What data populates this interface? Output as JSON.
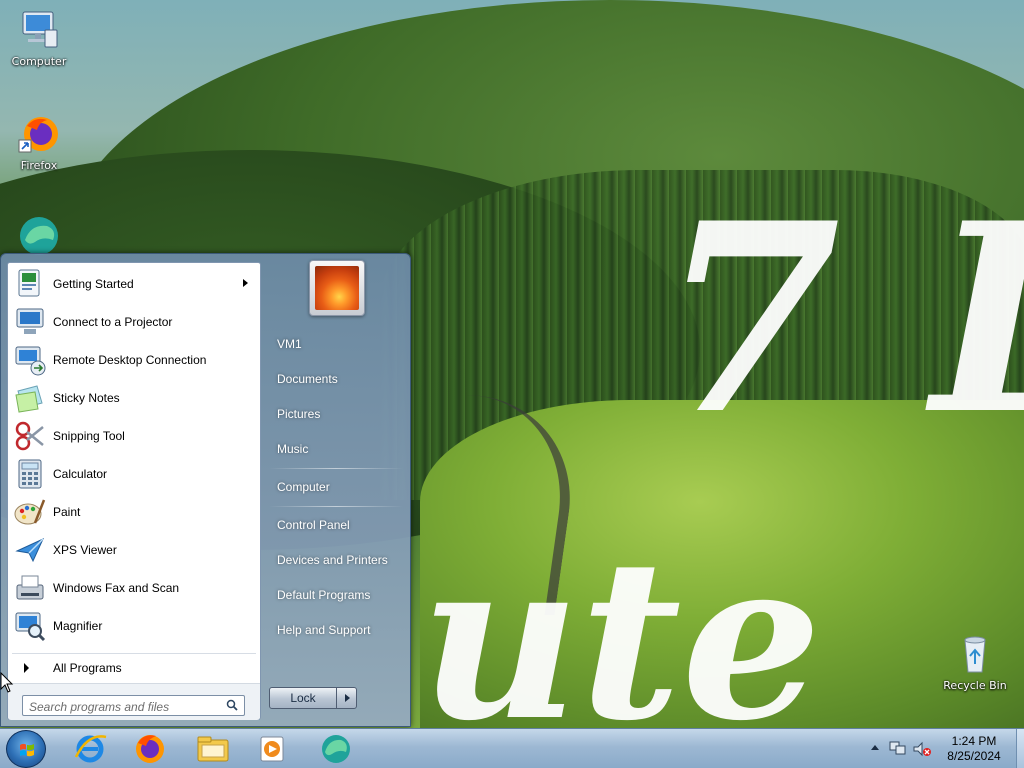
{
  "desktop": {
    "icons": [
      {
        "label": "Computer",
        "icon": "computer-icon"
      },
      {
        "label": "Firefox",
        "icon": "firefox-icon"
      },
      {
        "label": "",
        "icon": "edge-icon"
      },
      {
        "label": "Recycle Bin",
        "icon": "recycle-bin-icon"
      }
    ]
  },
  "start_menu": {
    "programs": [
      {
        "label": "Getting Started",
        "icon": "getting-started-icon",
        "has_submenu": true
      },
      {
        "label": "Connect to a Projector",
        "icon": "projector-icon"
      },
      {
        "label": "Remote Desktop Connection",
        "icon": "remote-desktop-icon"
      },
      {
        "label": "Sticky Notes",
        "icon": "sticky-notes-icon"
      },
      {
        "label": "Snipping Tool",
        "icon": "snipping-tool-icon"
      },
      {
        "label": "Calculator",
        "icon": "calculator-icon"
      },
      {
        "label": "Paint",
        "icon": "paint-icon"
      },
      {
        "label": "XPS Viewer",
        "icon": "xps-viewer-icon"
      },
      {
        "label": "Windows Fax and Scan",
        "icon": "fax-scan-icon"
      },
      {
        "label": "Magnifier",
        "icon": "magnifier-icon"
      }
    ],
    "all_programs_label": "All Programs",
    "search_placeholder": "Search programs and files",
    "right_items": [
      "VM1",
      "Documents",
      "Pictures",
      "Music",
      "Computer",
      "Control Panel",
      "Devices and Printers",
      "Default Programs",
      "Help and Support"
    ],
    "lock_label": "Lock"
  },
  "taskbar": {
    "pinned": [
      "internet-explorer-icon",
      "firefox-icon",
      "explorer-icon",
      "media-player-icon",
      "edge-icon"
    ],
    "clock_time": "1:24 PM",
    "clock_date": "8/25/2024"
  }
}
